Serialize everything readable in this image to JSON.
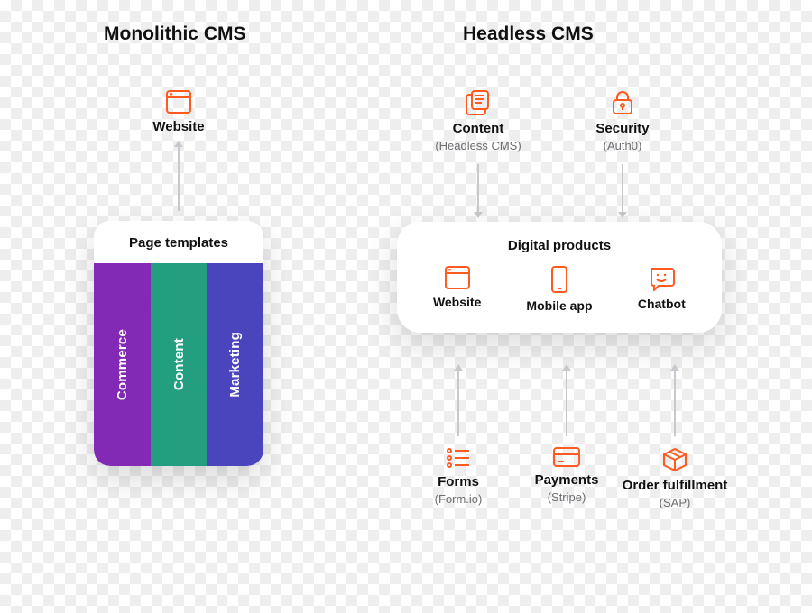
{
  "monolithic": {
    "title": "Monolithic CMS",
    "website_label": "Website",
    "card_header": "Page templates",
    "pillars": {
      "commerce": "Commerce",
      "content": "Content",
      "marketing": "Marketing"
    }
  },
  "headless": {
    "title": "Headless CMS",
    "top": {
      "content": {
        "label": "Content",
        "sub": "(Headless CMS)"
      },
      "security": {
        "label": "Security",
        "sub": "(Auth0)"
      }
    },
    "products": {
      "title": "Digital products",
      "website": "Website",
      "mobile": "Mobile app",
      "chatbot": "Chatbot"
    },
    "bottom": {
      "forms": {
        "label": "Forms",
        "sub": "(Form.io)"
      },
      "payments": {
        "label": "Payments",
        "sub": "(Stripe)"
      },
      "order": {
        "label": "Order fulfillment",
        "sub": "(SAP)"
      }
    }
  },
  "colors": {
    "accent": "#ff5a1f",
    "commerce": "#8229b6",
    "content": "#239f80",
    "marketing": "#4b45bd"
  }
}
